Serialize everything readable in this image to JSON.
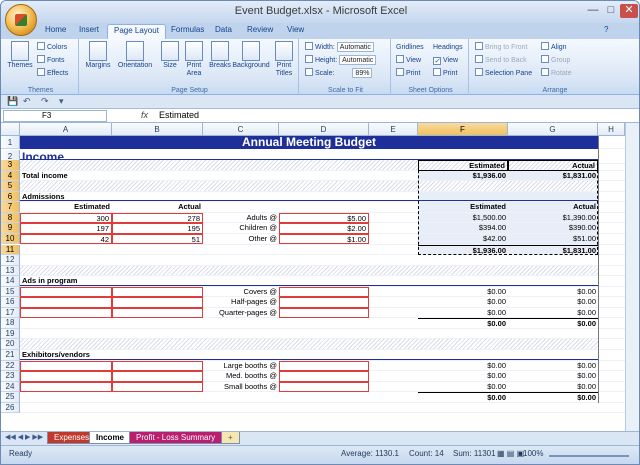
{
  "window": {
    "title": "Event Budget.xlsx - Microsoft Excel"
  },
  "ribbon_tabs": [
    "Home",
    "Insert",
    "Page Layout",
    "Formulas",
    "Data",
    "Review",
    "View"
  ],
  "active_tab": "Page Layout",
  "ribbon": {
    "themes": {
      "themes": "Themes",
      "colors": "Colors",
      "fonts": "Fonts",
      "effects": "Effects",
      "label": "Themes"
    },
    "page_setup": {
      "margins": "Margins",
      "orientation": "Orientation",
      "size": "Size",
      "print_area": "Print Area",
      "breaks": "Breaks",
      "background": "Background",
      "print_titles": "Print Titles",
      "label": "Page Setup"
    },
    "scale": {
      "width_label": "Width:",
      "width_value": "Automatic",
      "height_label": "Height:",
      "height_value": "Automatic",
      "scale_label": "Scale:",
      "scale_value": "89%",
      "label": "Scale to Fit"
    },
    "sheet_options": {
      "gridlines": "Gridlines",
      "headings": "Headings",
      "view": "View",
      "print": "Print",
      "label": "Sheet Options"
    },
    "arrange": {
      "bring_front": "Bring to Front",
      "send_back": "Send to Back",
      "selection_pane": "Selection Pane",
      "align": "Align",
      "group": "Group",
      "rotate": "Rotate",
      "label": "Arrange"
    }
  },
  "formula_bar": {
    "name_box": "F3",
    "fx": "fx",
    "content": "Estimated"
  },
  "columns": [
    "A",
    "B",
    "C",
    "D",
    "E",
    "F",
    "G",
    "H"
  ],
  "selected_column": "F",
  "rows": [
    "1",
    "2",
    "3",
    "4",
    "5",
    "6",
    "7",
    "8",
    "9",
    "10",
    "11",
    "12",
    "13",
    "14",
    "15",
    "16",
    "17",
    "18",
    "19",
    "20",
    "21",
    "22",
    "23",
    "24",
    "25",
    "26"
  ],
  "selected_rows": [
    "3",
    "4",
    "5",
    "6",
    "7",
    "8",
    "9",
    "10",
    "11"
  ],
  "sheet": {
    "banner": "Annual Meeting Budget",
    "section_title": "Income",
    "estimated": "Estimated",
    "actual": "Actual",
    "total_income_label": "Total income",
    "total_income_est": "$1,936.00",
    "total_income_act": "$1,831.00",
    "admissions": {
      "title": "Admissions",
      "est_hdr": "Estimated",
      "act_hdr": "Actual",
      "rows": [
        {
          "est": "300",
          "act": "278",
          "label": "Adults @",
          "price": "$5.00",
          "f": "$1,500.00",
          "g": "$1,390.00"
        },
        {
          "est": "197",
          "act": "195",
          "label": "Children @",
          "price": "$2.00",
          "f": "$394.00",
          "g": "$390.00"
        },
        {
          "est": "42",
          "act": "51",
          "label": "Other @",
          "price": "$1.00",
          "f": "$42.00",
          "g": "$51.00"
        }
      ],
      "total_f": "$1,936.00",
      "total_g": "$1,831.00"
    },
    "ads": {
      "title": "Ads in program",
      "rows": [
        {
          "label": "Covers @",
          "f": "$0.00",
          "g": "$0.00"
        },
        {
          "label": "Half-pages @",
          "f": "$0.00",
          "g": "$0.00"
        },
        {
          "label": "Quarter-pages @",
          "f": "$0.00",
          "g": "$0.00"
        }
      ],
      "total_f": "$0.00",
      "total_g": "$0.00"
    },
    "exhibitors": {
      "title": "Exhibitors/vendors",
      "rows": [
        {
          "label": "Large booths @",
          "f": "$0.00",
          "g": "$0.00"
        },
        {
          "label": "Med. booths @",
          "f": "$0.00",
          "g": "$0.00"
        },
        {
          "label": "Small booths @",
          "f": "$0.00",
          "g": "$0.00"
        }
      ],
      "total_f": "$0.00",
      "total_g": "$0.00"
    }
  },
  "sheet_tabs": [
    "Expenses",
    "Income",
    "Profit - Loss Summary"
  ],
  "active_sheet": "Income",
  "status": {
    "ready": "Ready",
    "average": "Average: 1130.1",
    "count": "Count: 14",
    "sum": "Sum: 11301",
    "zoom": "100%"
  },
  "colors": {
    "banner": "#1f2f9a",
    "section": "#1f2f9a",
    "input_border": "#e23b3b",
    "selection": "#e8eef8"
  }
}
